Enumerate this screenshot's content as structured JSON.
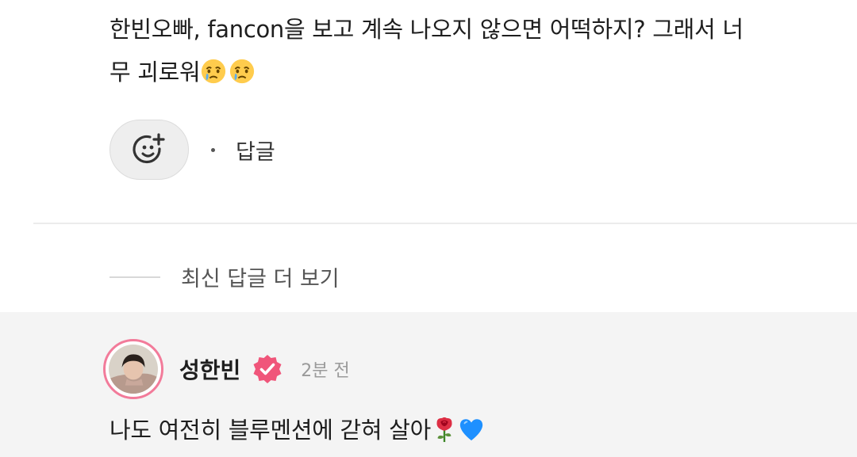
{
  "comment": {
    "text_line1": "한빈오빠, fancon을 보고 계속 나오지 않으면 어떡하지? 그래서 너",
    "text_line2": "무 괴로워",
    "emojis": [
      "crying-face-icon",
      "crying-face-icon"
    ]
  },
  "actions": {
    "reaction_icon": "add-reaction-icon",
    "reply_label": "답글"
  },
  "more_replies": {
    "label": "최신 답글 더 보기"
  },
  "artist_reply": {
    "author": "성한빈",
    "verified_icon": "verified-badge-icon",
    "time": "2분 전",
    "text": "나도 여전히 블루멘션에 갇혀 살아",
    "emojis": [
      "rose-icon",
      "blue-heart-icon"
    ]
  },
  "colors": {
    "accent_pink": "#f0557a",
    "avatar_ring": "#f27b9a",
    "reply_bg": "#f4f4f4",
    "heart_blue": "#1e90ff"
  }
}
